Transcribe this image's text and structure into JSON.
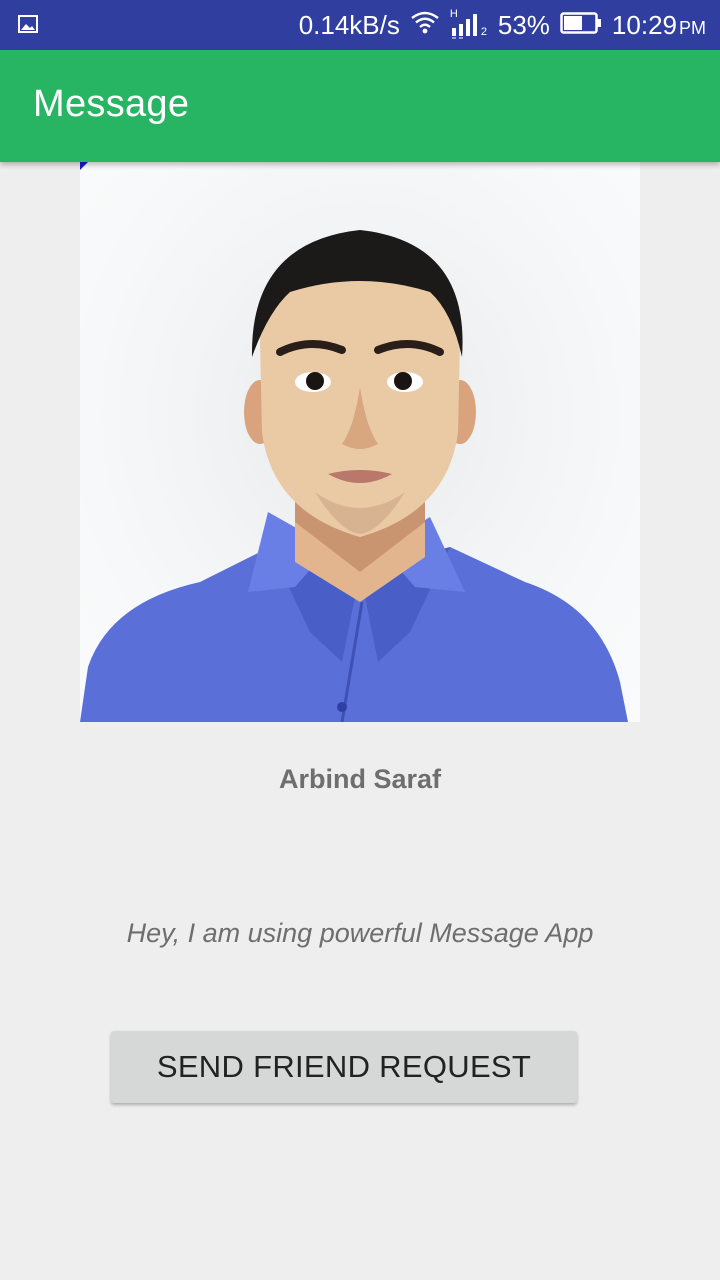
{
  "status_bar": {
    "net_speed": "0.14kB/s",
    "network_type": "H",
    "sim_slot": "2",
    "battery": "53%",
    "time": "10:29",
    "ampm": "PM",
    "icons": [
      "gallery-notification-icon",
      "wifi-icon",
      "signal-icon",
      "battery-icon"
    ]
  },
  "app_bar": {
    "title": "Message",
    "color": "#27b463"
  },
  "profile": {
    "name": "Arbind Saraf",
    "status": "Hey, I am using powerful Message App"
  },
  "actions": {
    "send_request_label": "SEND FRIEND REQUEST"
  },
  "colors": {
    "status_bar": "#303f9f",
    "background": "#eeeeee",
    "button": "#d6d7d7",
    "shirt": "#5a6fd8"
  }
}
